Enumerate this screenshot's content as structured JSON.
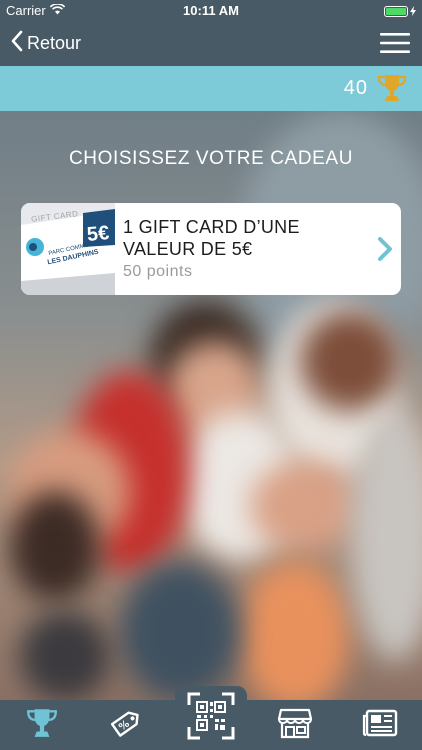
{
  "status_bar": {
    "carrier": "Carrier",
    "time": "10:11 AM"
  },
  "nav": {
    "back_label": "Retour",
    "menu_icon": "hamburger-menu-icon"
  },
  "points_bar": {
    "points": "40",
    "icon": "trophy-icon"
  },
  "page": {
    "title": "CHOISISSEZ VOTRE CADEAU"
  },
  "gift": {
    "title": "1 GIFT CARD D’UNE VALEUR DE 5€",
    "points": "50 points",
    "thumb_label": "GIFT CARD",
    "thumb_value": "5€",
    "thumb_brand_line1": "PARC COMMERCIAL",
    "thumb_brand_line2": "LES DAUPHINS"
  },
  "tabs": [
    {
      "icon": "trophy-icon"
    },
    {
      "icon": "coupon-tag-icon"
    },
    {
      "icon": "qr-scan-icon"
    },
    {
      "icon": "store-icon"
    },
    {
      "icon": "newspaper-icon"
    }
  ],
  "colors": {
    "nav_bg": "#485a66",
    "points_bar_bg": "#7dcbd8",
    "accent_gold": "#e0a62a",
    "accent_teal": "#6fc3d4",
    "battery_green": "#4cd964"
  }
}
